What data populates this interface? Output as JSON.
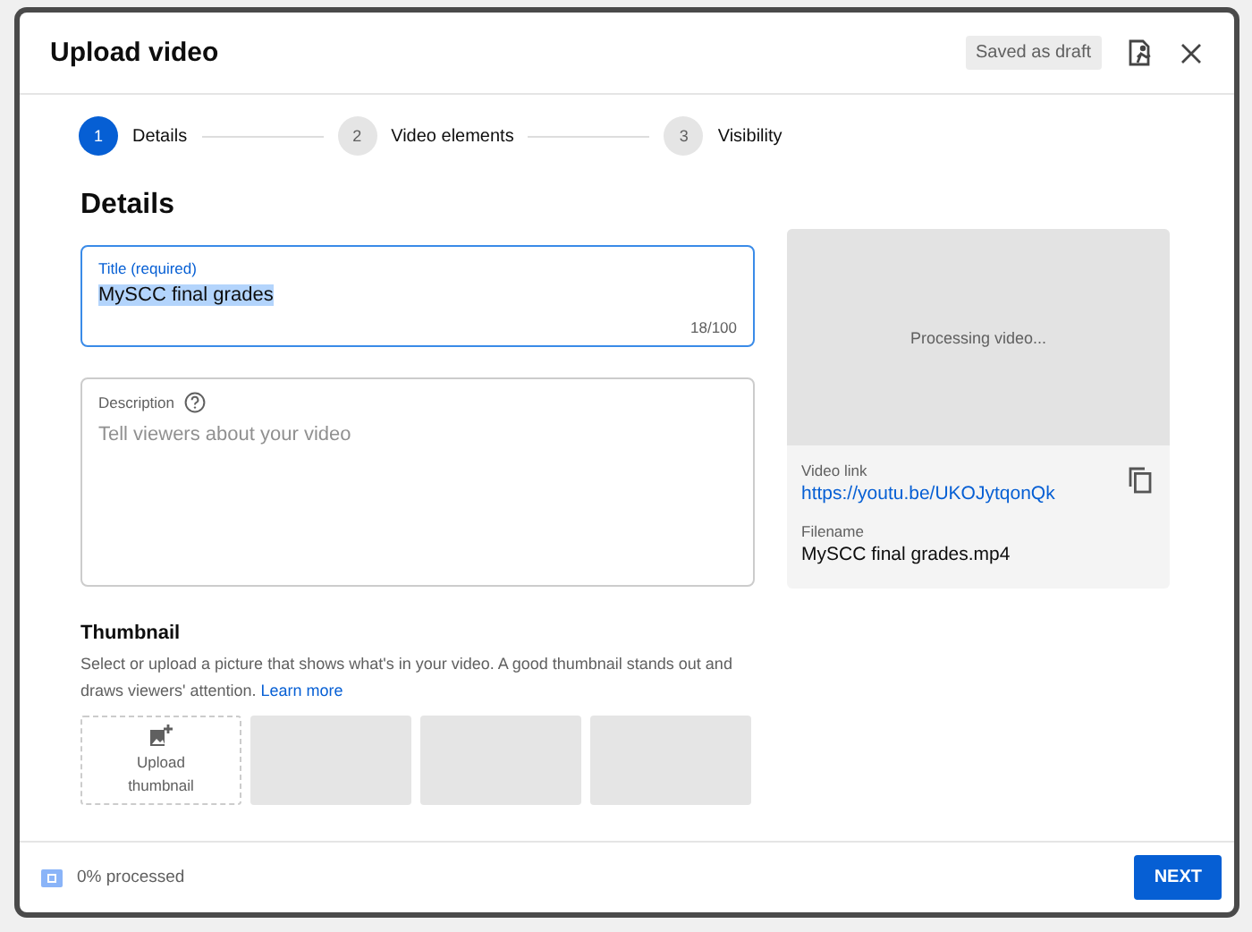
{
  "dialog": {
    "title": "Upload video",
    "draft_badge": "Saved as draft"
  },
  "steps": [
    {
      "number": "1",
      "label": "Details",
      "selected": true
    },
    {
      "number": "2",
      "label": "Video elements",
      "selected": false
    },
    {
      "number": "3",
      "label": "Visibility",
      "selected": false
    }
  ],
  "section_title": "Details",
  "title_field": {
    "label": "Title (required)",
    "value": "MySCC final grades",
    "counter": "18/100",
    "focused": true
  },
  "description_field": {
    "label": "Description",
    "placeholder": "Tell viewers about your video"
  },
  "thumbnail": {
    "heading": "Thumbnail",
    "text": "Select or upload a picture that shows what's in your video. A good thumbnail stands out and draws viewers' attention.",
    "link": "Learn more",
    "upload_label": "Upload thumbnail",
    "options": [
      {
        "kind": "placeholder"
      },
      {
        "kind": "placeholder"
      },
      {
        "kind": "placeholder"
      }
    ]
  },
  "preview": {
    "status": "Processing video...",
    "link_label": "Video link",
    "link": "https://youtu.be/UKOJytqonQk",
    "filename_label": "Filename",
    "filename": "MySCC final grades.mp4"
  },
  "footer": {
    "progress": "0% processed",
    "next_button": "NEXT"
  }
}
